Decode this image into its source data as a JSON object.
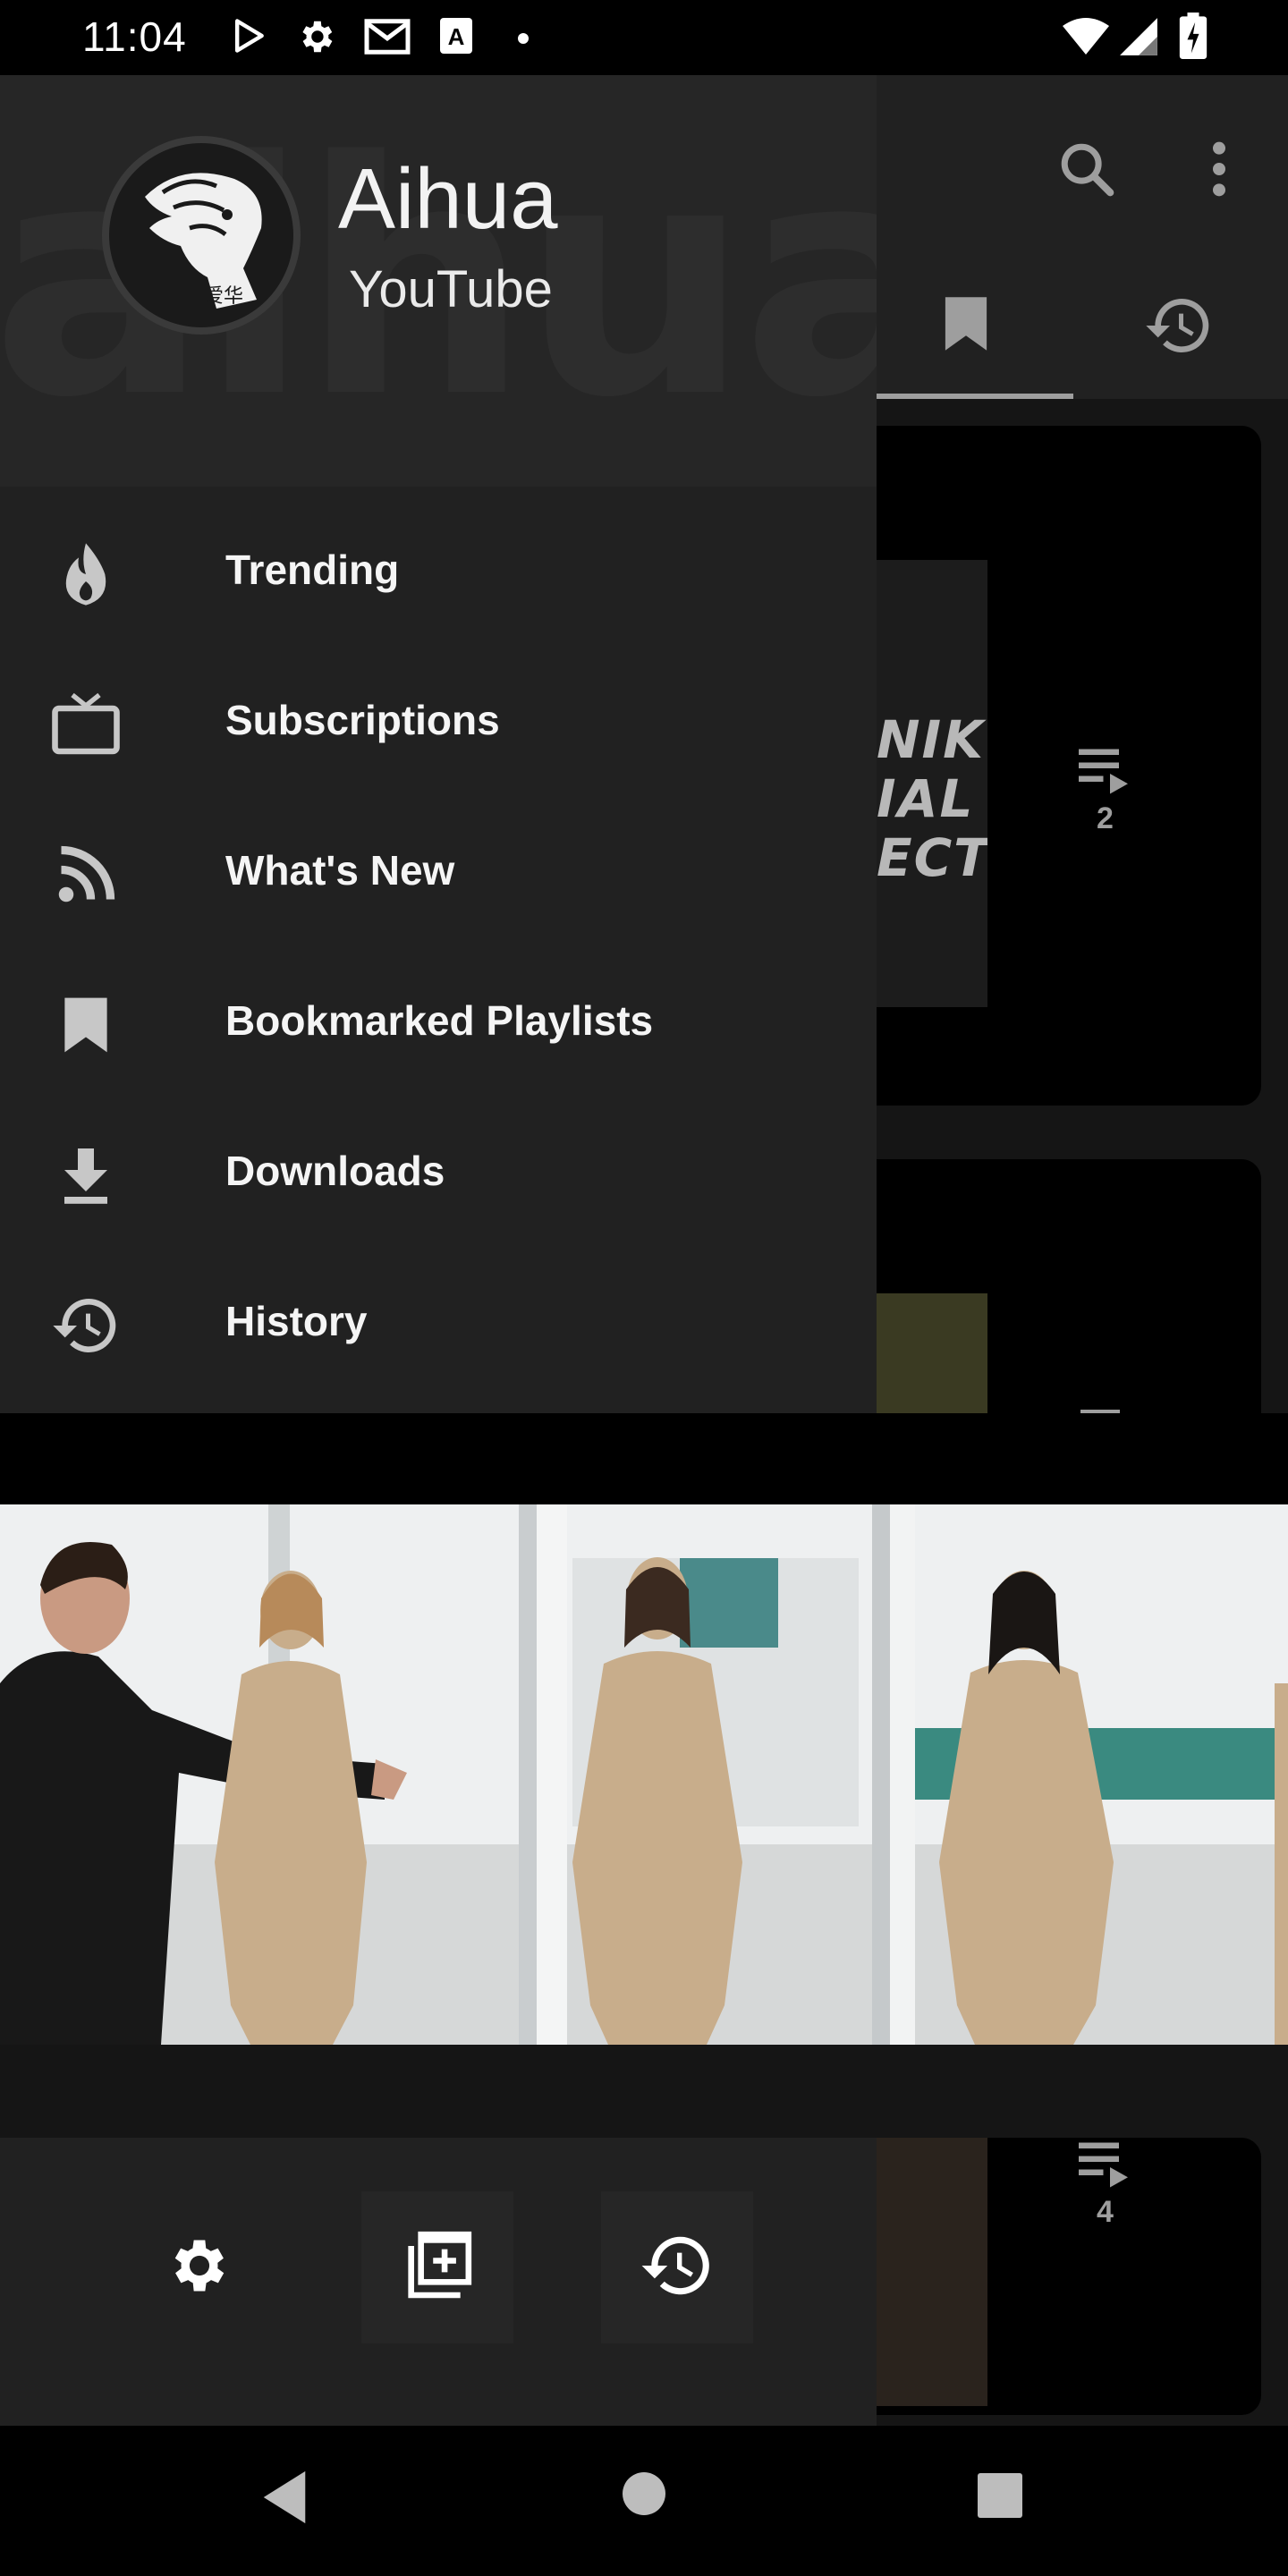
{
  "status_bar": {
    "time": "11:04",
    "icons": [
      "play-store-icon",
      "settings-icon",
      "gmail-icon",
      "font-a-icon",
      "dot-icon",
      "wifi-icon",
      "signal-icon",
      "battery-charging-icon"
    ]
  },
  "background_app": {
    "toolbar_icons": [
      "search-icon",
      "more-vert-icon"
    ],
    "tabs": [
      "bookmark-tab-icon",
      "history-tab-icon"
    ],
    "card1": {
      "thumb_text": "NIK\nIAL\nECT",
      "playlist_count": "2"
    },
    "card3": {
      "playlist_count": "4"
    }
  },
  "drawer": {
    "header": {
      "channel_name": "Aihua",
      "service_name": "YouTube",
      "watermark_text": "aihua",
      "avatar_caption": "爱华"
    },
    "items": [
      {
        "label": "Trending",
        "icon": "fire-icon"
      },
      {
        "label": "Subscriptions",
        "icon": "tv-icon"
      },
      {
        "label": "What's New",
        "icon": "rss-icon"
      },
      {
        "label": "Bookmarked Playlists",
        "icon": "bookmark-icon"
      },
      {
        "label": "Downloads",
        "icon": "download-icon"
      },
      {
        "label": "History",
        "icon": "history-icon"
      }
    ],
    "footer_buttons": [
      "settings-icon",
      "add-tab-icon",
      "history-icon"
    ]
  },
  "colors": {
    "drawer_bg": "#212121",
    "header_bg": "#262626",
    "background": "#151515",
    "text": "#f5f5f5"
  },
  "navbar": {
    "buttons": [
      "back-icon",
      "home-icon",
      "recents-icon"
    ]
  }
}
